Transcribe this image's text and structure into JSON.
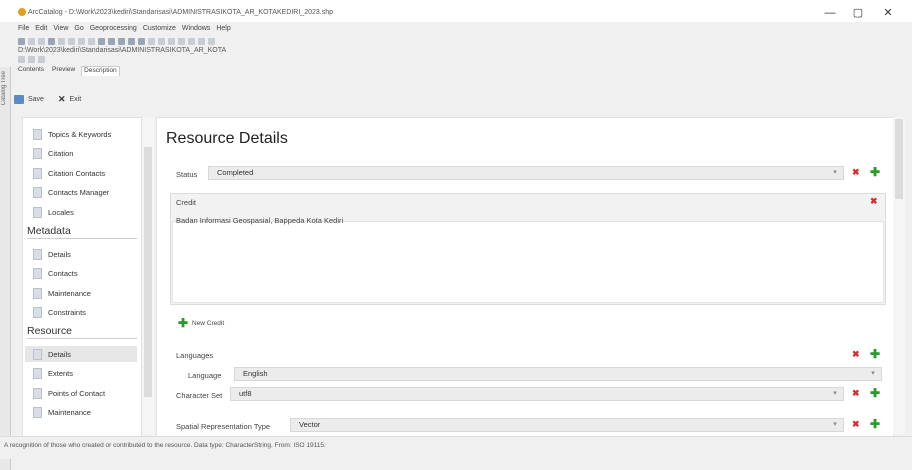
{
  "window": {
    "title": "ArcCatalog - D:\\Work\\2023\\kediri\\Standarisasi\\ADMINISTRASIKOTA_AR_KOTAKEDIRI_2023.shp",
    "minimize": "—",
    "maximize": "▢",
    "close": "✕"
  },
  "menu": [
    "File",
    "Edit",
    "View",
    "Go",
    "Geoprocessing",
    "Customize",
    "Windows",
    "Help"
  ],
  "location_path": "D:\\Work\\2023\\kediri\\Standarisasi\\ADMINISTRASIKOTA_AR_KOTA",
  "side_strip_label": "Catalog Tree",
  "tabs": [
    "Contents",
    "Preview",
    "Description"
  ],
  "edit_toolbar": {
    "save": "Save",
    "exit": "Exit"
  },
  "nav": {
    "top_items": [
      "Topics & Keywords",
      "Citation",
      "Citation Contacts",
      "Contacts Manager",
      "Locales"
    ],
    "metadata_heading": "Metadata",
    "metadata_items": [
      "Details",
      "Contacts",
      "Maintenance",
      "Constraints"
    ],
    "resource_heading": "Resource",
    "resource_items": [
      "Details",
      "Extents",
      "Points of Contact",
      "Maintenance"
    ]
  },
  "main": {
    "title": "Resource Details",
    "status_label": "Status",
    "status_value": "Completed",
    "credit_label": "Credit",
    "credit_value": "Badan Informasi Geospasial, Bappeda Kota Kediri",
    "new_credit": "New Credit",
    "languages_label": "Languages",
    "language_label": "Language",
    "language_value": "English",
    "charset_label": "Character Set",
    "charset_value": "utf8",
    "spatial_label": "Spatial Representation Type",
    "spatial_value": "Vector"
  },
  "status_bar": "A recognition of those who created or contributed to the resource. Data type: CharacterString. From: ISO 19115.",
  "colors": {
    "delete": "#d03030",
    "add": "#2a9a2a",
    "selected": "#e6e6e6"
  }
}
